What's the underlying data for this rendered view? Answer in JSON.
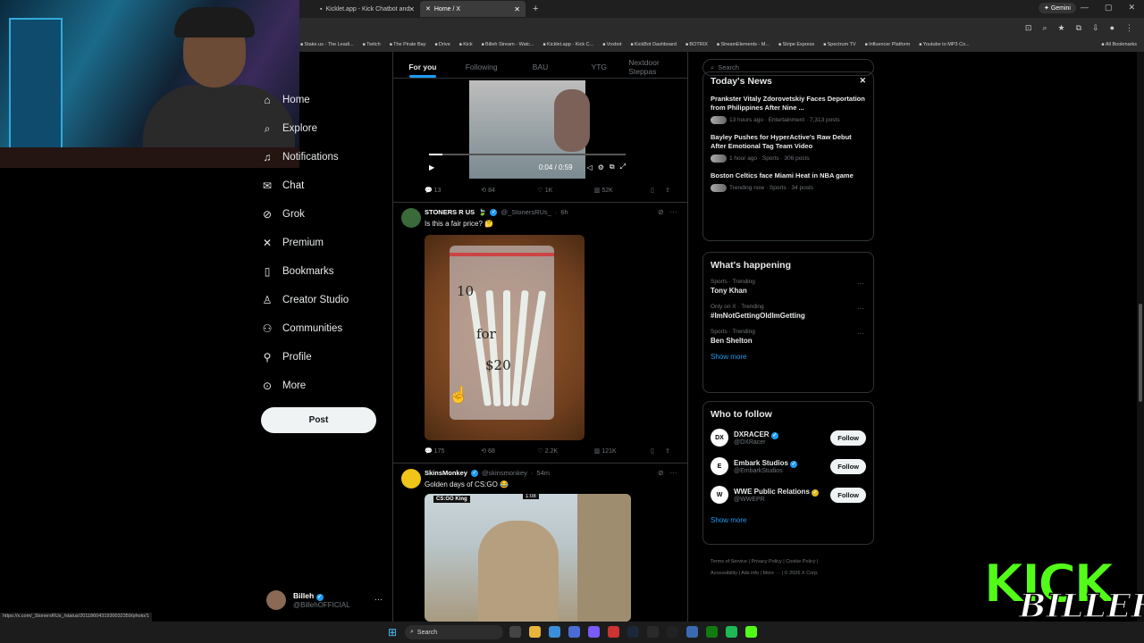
{
  "browser": {
    "tabs": [
      {
        "title": "Kicklet.app - Kick Chatbot and"
      },
      {
        "title": "Home / X"
      }
    ],
    "gemini_label": "Gemini",
    "bookmarks": [
      "Stake.us - The Leadi...",
      "Twitch",
      "The Pirate Bay",
      "Drive",
      "Kick",
      "Billeh Stream - Watc...",
      "Kicklet.app - Kick C...",
      "Voxbot",
      "KickBot Dashboard",
      "BOTRIX",
      "StreamElements - M...",
      "Stripe Express",
      "Spectrum TV",
      "Influencer Platform",
      "Youtube to MP3 Co..."
    ],
    "all_bookmarks": "All Bookmarks",
    "status_url": "https://x.com/_StonersRUs_/status/2011860431930032359/photo/1"
  },
  "sidebar": {
    "items": [
      {
        "label": "Home",
        "icon": "home-icon",
        "glyph": "⌂"
      },
      {
        "label": "Explore",
        "icon": "explore-icon",
        "glyph": "⌕"
      },
      {
        "label": "Notifications",
        "icon": "bell-icon",
        "glyph": "♫"
      },
      {
        "label": "Chat",
        "icon": "mail-icon",
        "glyph": "✉"
      },
      {
        "label": "Grok",
        "icon": "grok-icon",
        "glyph": "⊘"
      },
      {
        "label": "Premium",
        "icon": "x-logo-icon",
        "glyph": "✕"
      },
      {
        "label": "Bookmarks",
        "icon": "bookmark-icon",
        "glyph": "▯"
      },
      {
        "label": "Creator Studio",
        "icon": "creator-icon",
        "glyph": "♙"
      },
      {
        "label": "Communities",
        "icon": "communities-icon",
        "glyph": "⚇"
      },
      {
        "label": "Profile",
        "icon": "profile-icon",
        "glyph": "⚲"
      },
      {
        "label": "More",
        "icon": "more-icon",
        "glyph": "⊙"
      }
    ],
    "post_label": "Post",
    "account": {
      "name": "Billeh",
      "handle": "@BillehOFFICIAL"
    }
  },
  "feed": {
    "tabs": [
      "For you",
      "Following",
      "BAU",
      "YTG",
      "Nextdoor Steppas"
    ],
    "video1": {
      "time": "0:04 / 0:59",
      "progress": 0.07
    },
    "post1_stats": {
      "replies": "13",
      "reposts": "84",
      "likes": "1K",
      "views": "52K"
    },
    "post2": {
      "name": "STONERS R US",
      "handle": "@_StonersRUs_",
      "time": "6h",
      "text": "Is this a fair price? 🤔",
      "img_text": [
        "10",
        "for",
        "$20"
      ]
    },
    "post2_stats": {
      "replies": "175",
      "reposts": "68",
      "likes": "2.2K",
      "views": "121K"
    },
    "post3": {
      "name": "SkinsMonkey",
      "handle": "@skinsmonkey",
      "time": "54m",
      "text": "Golden days of CS:GO 😂",
      "video_label": "CS:GO King",
      "video_time": "1:08"
    }
  },
  "right": {
    "search_placeholder": "Search",
    "news_title": "Today's News",
    "news": [
      {
        "title": "Prankster Vitaly Zdorovetskiy Faces Deportation from Philippines After Nine ...",
        "meta": "13 hours ago · Entertainment · 7,313 posts"
      },
      {
        "title": "Bayley Pushes for HyperActive's Raw Debut After Emotional Tag Team Video",
        "meta": "1 hour ago · Sports · 306 posts"
      },
      {
        "title": "Boston Celtics face Miami Heat in NBA game",
        "meta": "Trending now · Sports · 34 posts"
      }
    ],
    "happening_title": "What's happening",
    "trends": [
      {
        "context": "Sports · Trending",
        "name": "Tony Khan"
      },
      {
        "context": "Only on X · Trending",
        "name": "#ImNotGettingOldImGetting"
      },
      {
        "context": "Sports · Trending",
        "name": "Ben Shelton"
      }
    ],
    "show_more": "Show more",
    "wtf_title": "Who to follow",
    "wtf": [
      {
        "name": "DXRACER",
        "handle": "@DXRacer",
        "badge": "blue",
        "avatar": "DX"
      },
      {
        "name": "Embark Studios",
        "handle": "@EmbarkStudios",
        "badge": "blue",
        "avatar": "E"
      },
      {
        "name": "WWE Public Relations",
        "handle": "@WWEPR",
        "badge": "gold",
        "avatar": "W"
      }
    ],
    "follow_label": "Follow",
    "footer": [
      "Terms of Service",
      "Privacy Policy",
      "Cookie Policy",
      "Accessibility",
      "Ads info",
      "More ···",
      "© 2026 X Corp."
    ]
  },
  "overlay": {
    "kick": "KICK",
    "billeh": "BILLEH"
  },
  "taskbar": {
    "search": "Search"
  }
}
